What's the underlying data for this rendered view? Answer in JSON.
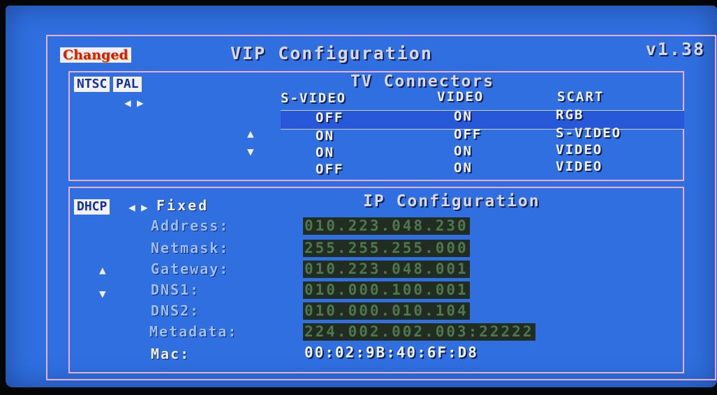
{
  "header": {
    "badge": "Changed",
    "title": "VIP Configuration",
    "version": "v1.38"
  },
  "tv": {
    "modes": [
      "NTSC",
      "PAL"
    ],
    "mode_arrows": [
      "◀",
      "▶"
    ],
    "section_title": "TV Connectors",
    "columns": [
      "S-VIDEO",
      "VIDEO",
      "SCART"
    ],
    "rows": [
      [
        "OFF",
        "ON",
        "RGB"
      ],
      [
        "ON",
        "OFF",
        "S-VIDEO"
      ],
      [
        "ON",
        "ON",
        "VIDEO"
      ],
      [
        "OFF",
        "ON",
        "VIDEO"
      ]
    ],
    "scroll_up": "▲",
    "scroll_down": "▼"
  },
  "ip": {
    "modes": [
      "DHCP",
      "Fixed"
    ],
    "mode_arrows": [
      "◀",
      "▶"
    ],
    "section_title": "IP Configuration",
    "fields": [
      {
        "label": "Address:",
        "value": "010.223.048.230"
      },
      {
        "label": "Netmask:",
        "value": "255.255.255.000"
      },
      {
        "label": "Gateway:",
        "value": "010.223.048.001"
      },
      {
        "label": "DNS1:",
        "value": "010.000.100.001"
      },
      {
        "label": "DNS2:",
        "value": "010.000.010.104"
      },
      {
        "label": "Metadata:",
        "value": "224.002.002.003:22222"
      }
    ],
    "mac": {
      "label": "Mac:",
      "value": "00:02:9B:40:6F:D8"
    },
    "scroll_up": "▲",
    "scroll_down": "▼"
  },
  "colors": {
    "screen_bg": "#2f6fe0",
    "frame": "#e8b0d8",
    "field_bg": "#222d22",
    "field_text": "#4f774f",
    "label_blue": "#9cc0ff",
    "changed_text": "#c8201c"
  }
}
